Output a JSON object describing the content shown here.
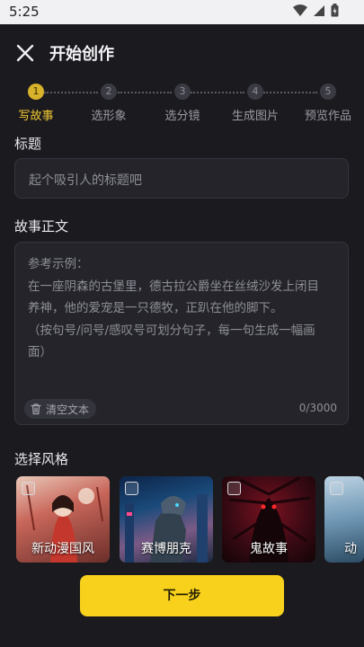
{
  "status_bar": {
    "time": "5:25"
  },
  "header": {
    "title": "开始创作"
  },
  "steps": [
    {
      "number": "1",
      "label": "写故事"
    },
    {
      "number": "2",
      "label": "选形象"
    },
    {
      "number": "3",
      "label": "选分镜"
    },
    {
      "number": "4",
      "label": "生成图片"
    },
    {
      "number": "5",
      "label": "预览作品"
    }
  ],
  "active_step": 1,
  "title_section": {
    "label": "标题",
    "placeholder": "起个吸引人的标题吧"
  },
  "story_section": {
    "label": "故事正文",
    "placeholder_lines": [
      "参考示例：",
      "在一座阴森的古堡里，德古拉公爵坐在丝绒沙发上闭目",
      "养神，他的爱宠是一只德牧，正趴在他的脚下。",
      "（按句号/问号/感叹号可划分句子，每一句生成一幅画",
      "面）"
    ],
    "clear_label": "清空文本",
    "counter": "0/3000"
  },
  "style_section": {
    "label": "选择风格",
    "styles": [
      {
        "name": "新动漫国风"
      },
      {
        "name": "赛博朋克"
      },
      {
        "name": "鬼故事"
      },
      {
        "name": "动"
      }
    ]
  },
  "next_button": {
    "label": "下一步"
  },
  "colors": {
    "accent": "#f7d11b",
    "active_step": "#f4c932",
    "background": "#1b1b1f"
  }
}
